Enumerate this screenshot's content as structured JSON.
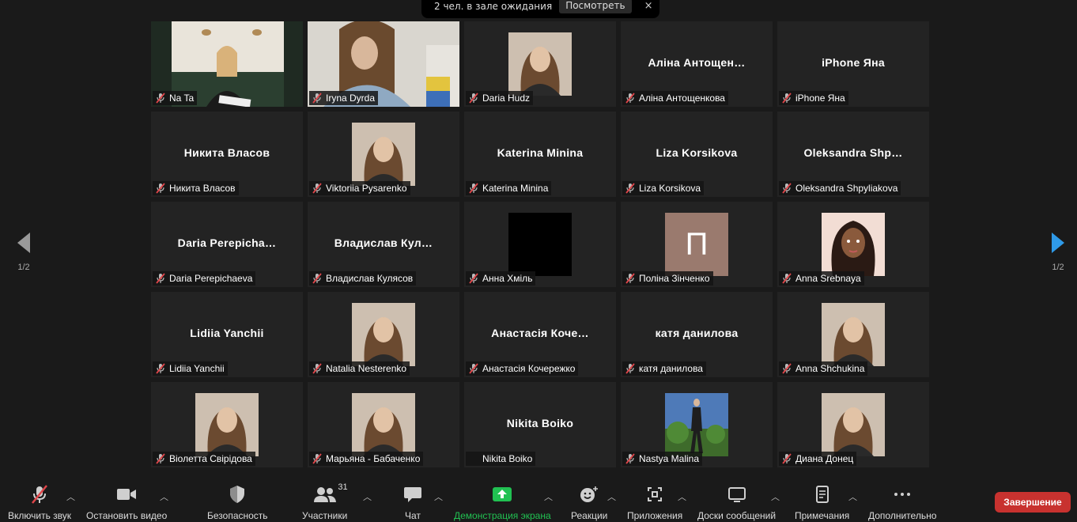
{
  "waiting": {
    "text": "2 чел. в зале ожидания",
    "button": "Посмотреть",
    "close": "×"
  },
  "page": {
    "left": "1/2",
    "right": "1/2"
  },
  "participants": [
    {
      "label": "Na Ta",
      "name": "",
      "photo": "wide-room",
      "active": true
    },
    {
      "label": "Iryna Dyrda",
      "name": "",
      "photo": "wide-woman"
    },
    {
      "label": "Daria Hudz",
      "name": "",
      "photo": "face"
    },
    {
      "label": "Аліна Антощенкова",
      "name": "Аліна Антощен…"
    },
    {
      "label": "iPhone Яна",
      "name": "iPhone Яна"
    },
    {
      "label": "Никита Власов",
      "name": "Никита Власов"
    },
    {
      "label": "Viktoriia Pysarenko",
      "name": "",
      "photo": "face"
    },
    {
      "label": "Katerina Minina",
      "name": "Katerina Minina"
    },
    {
      "label": "Liza Korsikova",
      "name": "Liza Korsikova"
    },
    {
      "label": "Oleksandra Shpyliakova",
      "name": "Oleksandra Shp…"
    },
    {
      "label": "Daria Perepichaeva",
      "name": "Daria Perepicha…"
    },
    {
      "label": "Владислав Кулясов",
      "name": "Владислав Кул…"
    },
    {
      "label": "Анна Хміль",
      "name": "",
      "photo": "black"
    },
    {
      "label": "Поліна Зінченко",
      "name": "",
      "photo": "letter",
      "letter": "П"
    },
    {
      "label": "Anna Srebnaya",
      "name": "",
      "photo": "cartoon"
    },
    {
      "label": "Lidiia Yanchii",
      "name": "Lidiia Yanchii"
    },
    {
      "label": "Natalia Nesterenko",
      "name": "",
      "photo": "face"
    },
    {
      "label": "Анастасія Кочережко",
      "name": "Анастасія Коче…"
    },
    {
      "label": "катя данилова",
      "name": "катя данилова"
    },
    {
      "label": "Anna Shchukina",
      "name": "",
      "photo": "face"
    },
    {
      "label": "Віолетта Свірідова",
      "name": "",
      "photo": "face"
    },
    {
      "label": "Марьяна - Бабаченко",
      "name": "",
      "photo": "face"
    },
    {
      "label": "Nikita Boiko",
      "name": "Nikita Boiko",
      "nomute": true
    },
    {
      "label": "Nastya Malina",
      "name": "",
      "photo": "outdoor"
    },
    {
      "label": "Диана Донец",
      "name": "",
      "photo": "face"
    }
  ],
  "toolbar": {
    "unmute": "Включить звук",
    "stop_video": "Остановить видео",
    "security": "Безопасность",
    "participants": "Участники",
    "participants_count": "31",
    "chat": "Чат",
    "share": "Демонстрация экрана",
    "reactions": "Реакции",
    "apps": "Приложения",
    "whiteboards": "Доски сообщений",
    "notes": "Примечания",
    "more": "Дополнительно",
    "end": "Завершение"
  },
  "colors": {
    "active_border": "#d8ef8a",
    "share_green": "#21c152",
    "end_red": "#c8322f",
    "muted_red": "#e0464a"
  }
}
